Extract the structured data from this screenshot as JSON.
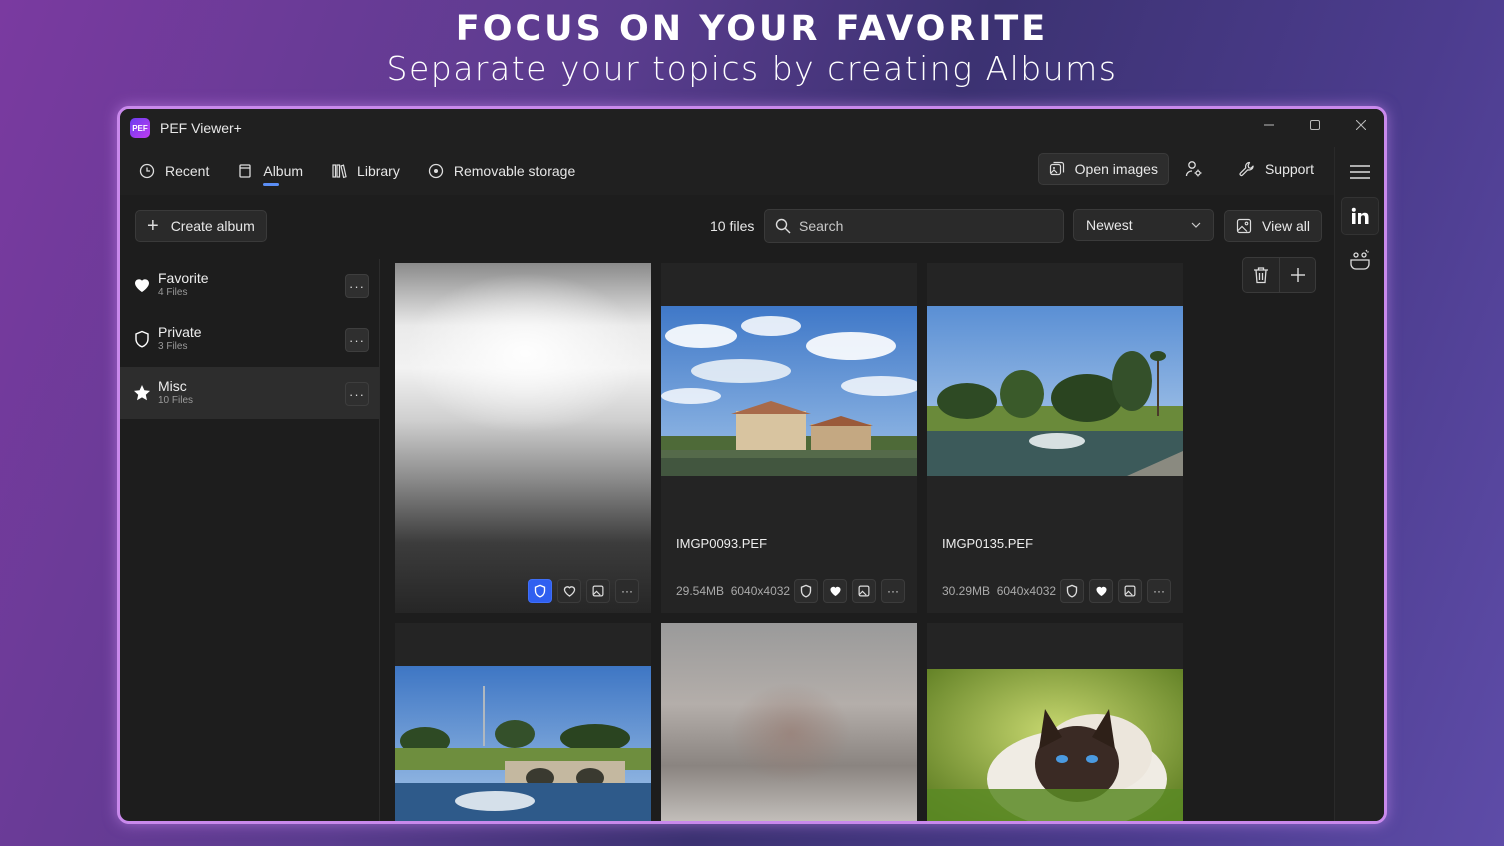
{
  "promo": {
    "title": "FOCUS ON YOUR FAVORITE",
    "subtitle": "Separate your topics by creating Albums"
  },
  "window": {
    "logo_text": "PEF",
    "title": "PEF Viewer+",
    "controls": [
      "minimize-icon",
      "maximize-icon",
      "close-icon"
    ]
  },
  "nav": {
    "items": [
      {
        "label": "Recent",
        "icon": "clock-icon"
      },
      {
        "label": "Album",
        "icon": "album-icon",
        "active": true
      },
      {
        "label": "Library",
        "icon": "library-icon"
      },
      {
        "label": "Removable storage",
        "icon": "disc-icon"
      }
    ],
    "open_images": "Open images",
    "support": "Support"
  },
  "toolbar": {
    "create_album": "Create album",
    "file_count": "10 files",
    "search_placeholder": "Search",
    "sort_value": "Newest",
    "view_all": "View all"
  },
  "albums": [
    {
      "name": "Favorite",
      "count": "4 Files",
      "icon": "heart-icon"
    },
    {
      "name": "Private",
      "count": "3 Files",
      "icon": "shield-icon"
    },
    {
      "name": "Misc",
      "count": "10 Files",
      "icon": "star-icon",
      "selected": true
    }
  ],
  "files": [
    {
      "name": "",
      "size": "",
      "resolution": ""
    },
    {
      "name": "IMGP0093.PEF",
      "size": "29.54MB",
      "resolution": "6040x4032"
    },
    {
      "name": "IMGP0135.PEF",
      "size": "30.29MB",
      "resolution": "6040x4032"
    }
  ],
  "colors": {
    "accent": "#2f5ff0",
    "frame_border": "#c989ec",
    "window_bg": "#1d1d1d"
  }
}
